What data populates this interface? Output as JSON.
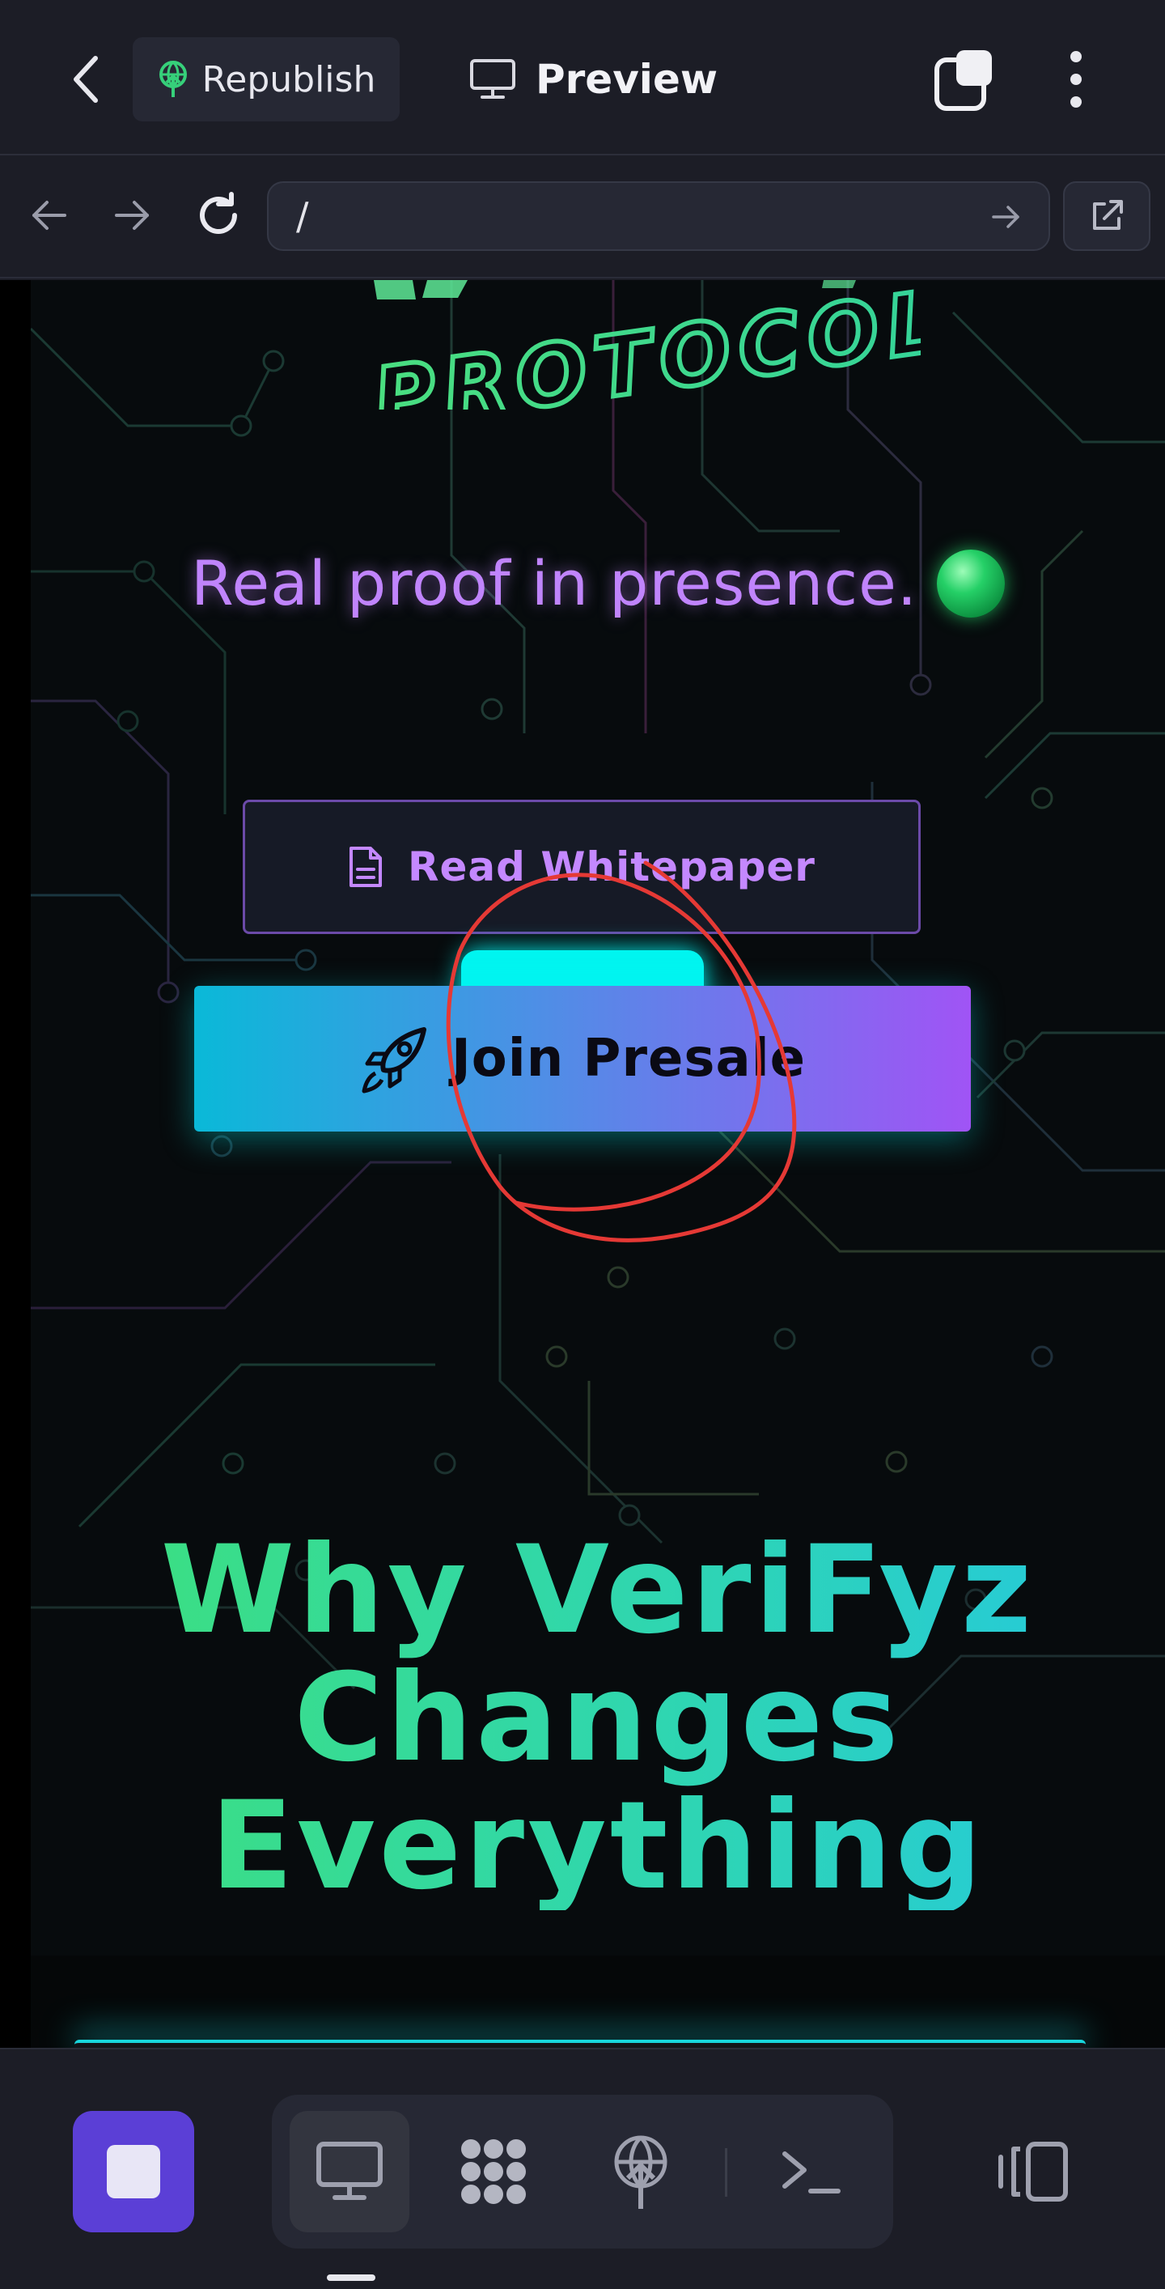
{
  "topbar": {
    "republish_label": "Republish",
    "preview_label": "Preview"
  },
  "navbar": {
    "url": "/"
  },
  "site": {
    "logo_text": "PROTOCOL",
    "tagline": "Real proof in presence.",
    "whitepaper_label": "Read Whitepaper",
    "presale_label": "Join Presale",
    "heading_lines": [
      "Why VeriFyz",
      "Changes",
      "Everything"
    ]
  },
  "colors": {
    "accent_purple": "#c084fc",
    "presale_gradient_start": "#0ab9d8",
    "presale_gradient_end": "#a054f5",
    "heading_green": "#3ee07a",
    "heading_cyan": "#24c8e0",
    "stop_button": "#5b3fd6",
    "annotation_red": "#e53935"
  },
  "icons": {
    "republish": "antenna-icon",
    "preview": "monitor-icon",
    "whitepaper": "document-icon",
    "presale": "rocket-icon"
  }
}
